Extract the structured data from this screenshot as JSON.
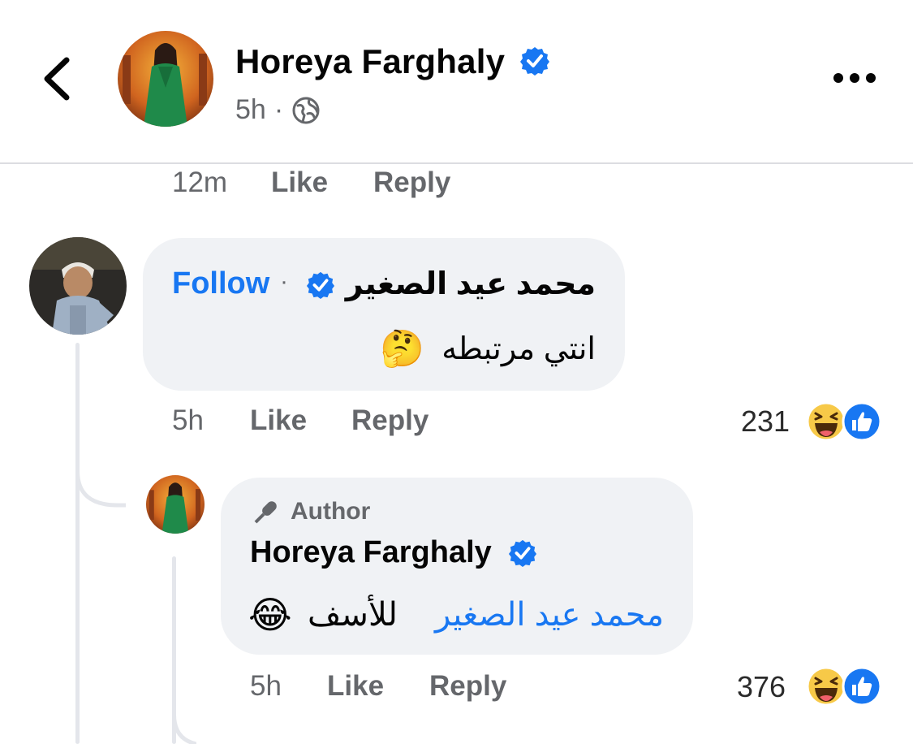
{
  "header": {
    "page_name": "Horeya Farghaly",
    "time": "5h",
    "dot": "·"
  },
  "prev_comment_meta": {
    "time": "12m",
    "like": "Like",
    "reply": "Reply"
  },
  "comment": {
    "author": "محمد عيد  الصغير",
    "dot": "·",
    "follow": "Follow",
    "text": "انتي مرتبطه",
    "emoji": "🤔",
    "time": "5h",
    "like": "Like",
    "reply": "Reply",
    "reaction_count": "231"
  },
  "reply": {
    "badge": "Author",
    "author": "Horeya Farghaly",
    "mention": "محمد عيد الصغير",
    "text": "للأسف",
    "emoji": "😂",
    "time": "5h",
    "like": "Like",
    "reply": "Reply",
    "reaction_count": "376"
  },
  "colors": {
    "accent": "#1877f2",
    "muted": "#65676b",
    "bubble": "#f0f2f5"
  }
}
